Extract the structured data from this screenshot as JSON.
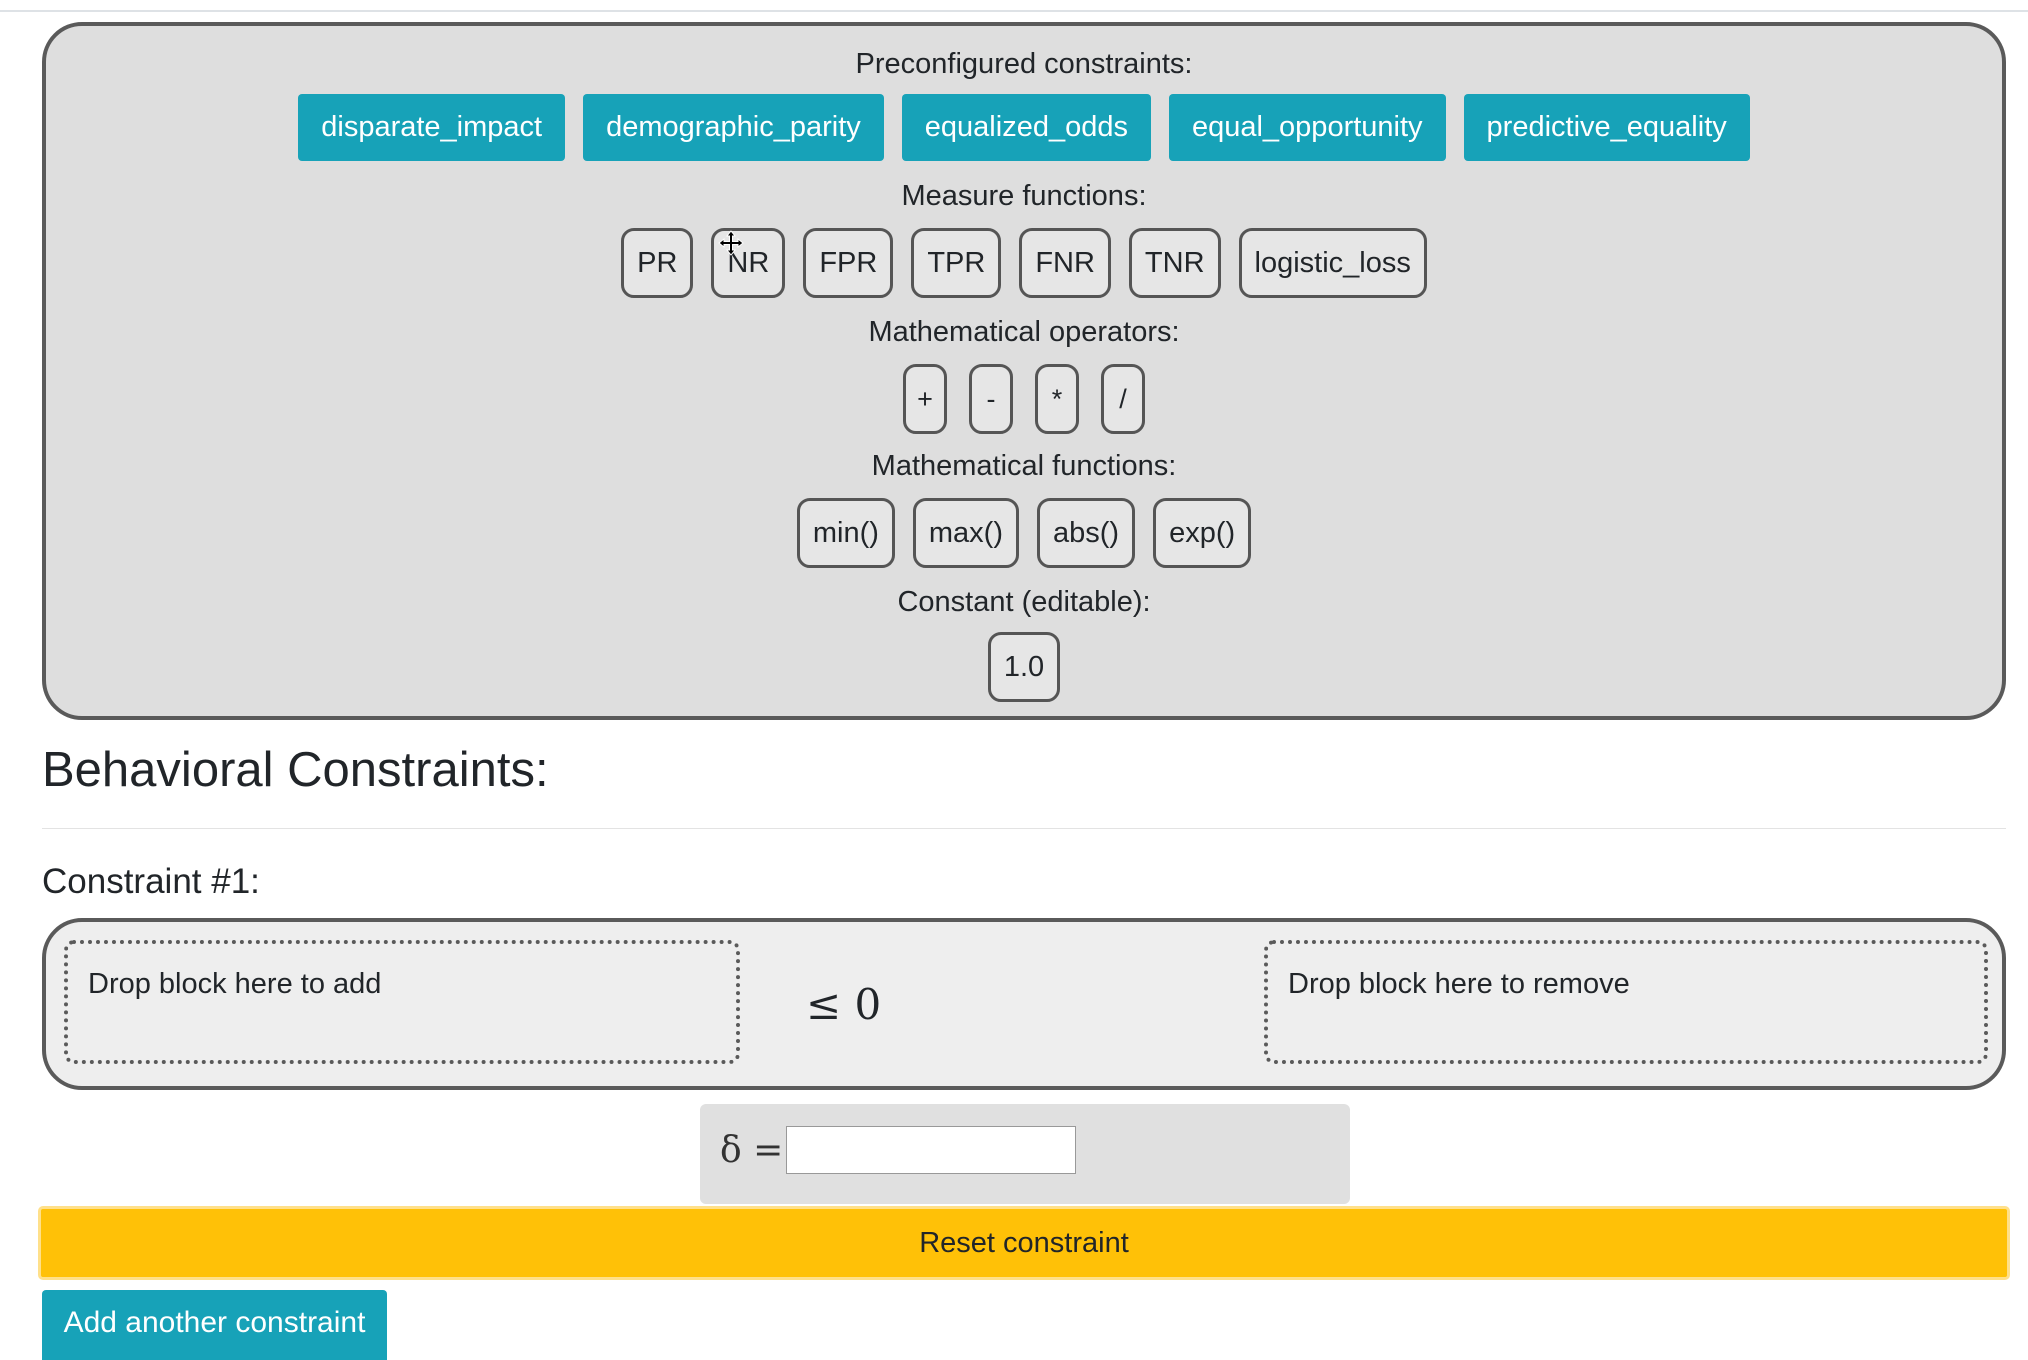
{
  "palette": {
    "preconfigured_label": "Preconfigured constraints:",
    "preconfigured": [
      "disparate_impact",
      "demographic_parity",
      "equalized_odds",
      "equal_opportunity",
      "predictive_equality"
    ],
    "measure_label": "Measure functions:",
    "measures": [
      "PR",
      "NR",
      "FPR",
      "TPR",
      "FNR",
      "TNR",
      "logistic_loss"
    ],
    "operators_label": "Mathematical operators:",
    "operators": [
      "+",
      "-",
      "*",
      "/"
    ],
    "functions_label": "Mathematical functions:",
    "functions": [
      "min()",
      "max()",
      "abs()",
      "exp()"
    ],
    "constant_label": "Constant (editable):",
    "constant_value": "1.0"
  },
  "section": {
    "heading": "Behavioral Constraints:"
  },
  "constraint": {
    "label": "Constraint #1:",
    "add_zone": "Drop block here to add",
    "relation": "≤ 0",
    "remove_zone": "Drop block here to remove",
    "delta_label": "δ =",
    "delta_value": ""
  },
  "buttons": {
    "reset": "Reset constraint",
    "add_another": "Add another constraint"
  },
  "colors": {
    "preset_bg": "#17a2b8",
    "reset_bg": "#ffc107",
    "panel_bg": "#dedede",
    "block_border": "#555555"
  },
  "cursor": {
    "icon": "move-cursor-icon"
  }
}
